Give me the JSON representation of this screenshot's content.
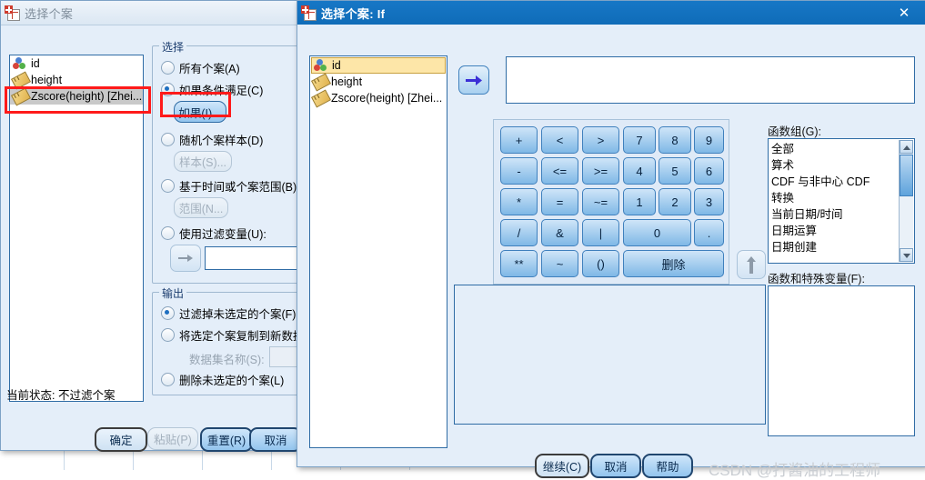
{
  "background": {
    "name": "data-sheet-grid"
  },
  "select_cases_dialog": {
    "title": "选择个案",
    "variables": [
      {
        "label": "id",
        "icon": "nominal-icon"
      },
      {
        "label": "height",
        "icon": "scale-icon"
      },
      {
        "label": "Zscore(height) [Zhei...",
        "icon": "scale-icon"
      }
    ],
    "select_group": {
      "legend": "选择",
      "options": [
        {
          "label": "所有个案(A)",
          "selected": false
        },
        {
          "label": "如果条件满足(C)",
          "selected": true
        },
        {
          "label": "随机个案样本(D)",
          "selected": false
        },
        {
          "label": "基于时间或个案范围(B)",
          "selected": false
        },
        {
          "label": "使用过滤变量(U):",
          "selected": false
        }
      ],
      "if_button": "如果(I)...",
      "sample_button": "样本(S)...",
      "range_button": "范围(N...",
      "filter_value": ""
    },
    "output_group": {
      "legend": "输出",
      "options": [
        {
          "label": "过滤掉未选定的个案(F)",
          "selected": true
        },
        {
          "label": "将选定个案复制到新数据集",
          "selected": false
        },
        {
          "label": "删除未选定的个案(L)",
          "selected": false
        }
      ],
      "dataset_name_label": "数据集名称(S):",
      "dataset_name_value": ""
    },
    "status_text": "当前状态: 不过滤个案",
    "buttons": {
      "ok": "确定",
      "paste": "粘贴(P)",
      "reset": "重置(R)",
      "cancel": "取消"
    }
  },
  "if_dialog": {
    "title": "选择个案: If",
    "close_label": "✕",
    "variables": [
      {
        "label": "id",
        "icon": "nominal-icon",
        "selected": true
      },
      {
        "label": "height",
        "icon": "scale-icon",
        "selected": false
      },
      {
        "label": "Zscore(height) [Zhei...",
        "icon": "scale-icon",
        "selected": false
      }
    ],
    "expression_value": "",
    "keypad": {
      "rows": [
        [
          "+",
          "<",
          ">",
          "7",
          "8",
          "9"
        ],
        [
          "-",
          "<=",
          ">=",
          "4",
          "5",
          "6"
        ],
        [
          "*",
          "=",
          "~=",
          "1",
          "2",
          "3"
        ],
        [
          "/",
          "&",
          "|",
          "0",
          "."
        ],
        [
          "**",
          "~",
          "()",
          "删除"
        ]
      ]
    },
    "function_group_label": "函数组(G):",
    "function_groups": [
      "全部",
      "算术",
      "CDF 与非中心 CDF",
      "转换",
      "当前日期/时间",
      "日期运算",
      "日期创建"
    ],
    "functions_label": "函数和特殊变量(F):",
    "functions": [],
    "buttons": {
      "continue": "继续(C)",
      "cancel": "取消",
      "help": "帮助"
    }
  },
  "watermark": "CSDN @打酱油的工程师",
  "colors": {
    "title_active": "#0f6cb8",
    "dialog_bg": "#e4eef9",
    "annotation_red": "#ff1a1a",
    "selection_yellow": "#fde6a8",
    "selection_grey": "#c9c9c9"
  }
}
